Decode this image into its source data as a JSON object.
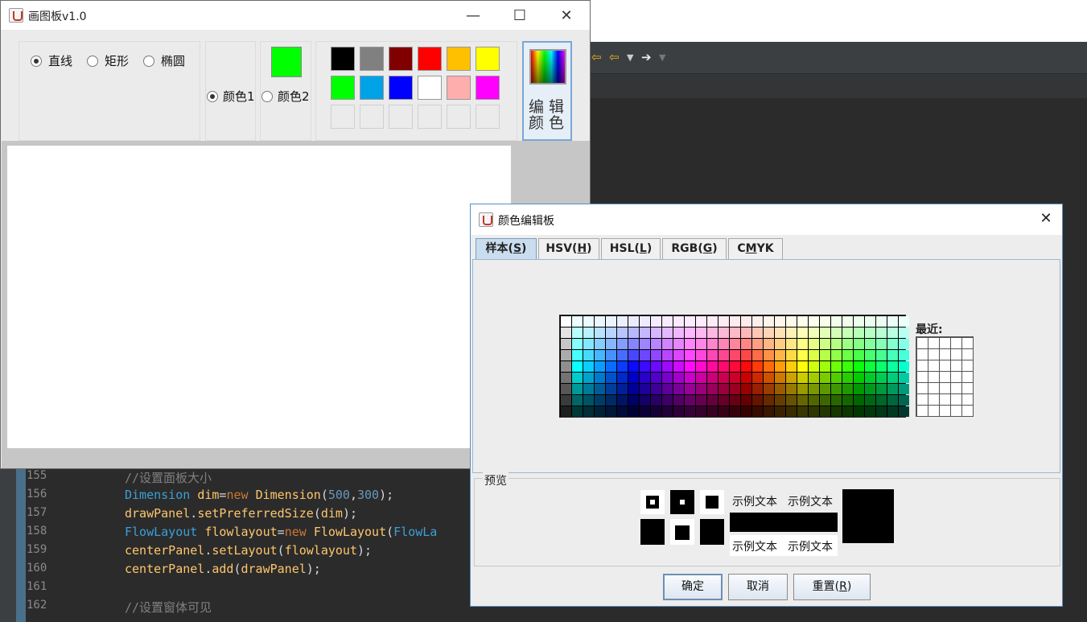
{
  "ide": {
    "code_lines": [
      {
        "num": "155",
        "parts": [
          {
            "c": "cm",
            "t": "//设置面板大小"
          }
        ]
      },
      {
        "num": "156",
        "parts": [
          {
            "c": "ty",
            "t": "Dimension"
          },
          {
            "c": "pl",
            "t": " "
          },
          {
            "c": "va",
            "t": "dim"
          },
          {
            "c": "pl",
            "t": "="
          },
          {
            "c": "kw",
            "t": "new"
          },
          {
            "c": "pl",
            "t": " "
          },
          {
            "c": "va",
            "t": "Dimension"
          },
          {
            "c": "pl",
            "t": "("
          },
          {
            "c": "nu",
            "t": "500"
          },
          {
            "c": "pl",
            "t": ","
          },
          {
            "c": "nu",
            "t": "300"
          },
          {
            "c": "pl",
            "t": ");"
          }
        ]
      },
      {
        "num": "157",
        "parts": [
          {
            "c": "va",
            "t": "drawPanel"
          },
          {
            "c": "pl",
            "t": "."
          },
          {
            "c": "va",
            "t": "setPreferredSize"
          },
          {
            "c": "pl",
            "t": "("
          },
          {
            "c": "va",
            "t": "dim"
          },
          {
            "c": "pl",
            "t": ");"
          }
        ]
      },
      {
        "num": "158",
        "parts": [
          {
            "c": "ty",
            "t": "FlowLayout"
          },
          {
            "c": "pl",
            "t": " "
          },
          {
            "c": "va",
            "t": "flowlayout"
          },
          {
            "c": "pl",
            "t": "="
          },
          {
            "c": "kw",
            "t": "new"
          },
          {
            "c": "pl",
            "t": " "
          },
          {
            "c": "va",
            "t": "FlowLayout"
          },
          {
            "c": "pl",
            "t": "("
          },
          {
            "c": "ty",
            "t": "FlowLa"
          }
        ]
      },
      {
        "num": "159",
        "parts": [
          {
            "c": "va",
            "t": "centerPanel"
          },
          {
            "c": "pl",
            "t": "."
          },
          {
            "c": "va",
            "t": "setLayout"
          },
          {
            "c": "pl",
            "t": "("
          },
          {
            "c": "va",
            "t": "flowlayout"
          },
          {
            "c": "pl",
            "t": ");"
          }
        ]
      },
      {
        "num": "160",
        "parts": [
          {
            "c": "va",
            "t": "centerPanel"
          },
          {
            "c": "pl",
            "t": "."
          },
          {
            "c": "va",
            "t": "add"
          },
          {
            "c": "pl",
            "t": "("
          },
          {
            "c": "va",
            "t": "drawPanel"
          },
          {
            "c": "pl",
            "t": ");"
          }
        ]
      },
      {
        "num": "161",
        "parts": []
      },
      {
        "num": "162",
        "parts": [
          {
            "c": "cm",
            "t": "//设置窗体可见"
          }
        ]
      }
    ],
    "toolbar_icons": [
      "arrow-left-icon",
      "arrow-left-icon",
      "dropdown-icon",
      "arrow-right-icon",
      "dropdown-icon"
    ]
  },
  "app": {
    "title": "画图板v1.0",
    "shapes": [
      "直线",
      "矩形",
      "椭圆"
    ],
    "selected_shape": "直线",
    "color1_label": "颜色1",
    "color2_label": "颜色2",
    "selected_color_slot": "颜色1",
    "current_color": "#00ff00",
    "palette_row1": [
      "#000000",
      "#808080",
      "#800000",
      "#ff0000",
      "#ffc000",
      "#ffff00"
    ],
    "palette_row2": [
      "#00ff00",
      "#00a2e8",
      "#0000ff",
      "#ffffff",
      "#ffaeae",
      "#ff00ff"
    ],
    "edit_color_label": "编辑颜色"
  },
  "dialog": {
    "title": "颜色编辑板",
    "tabs": [
      {
        "label": "样本(",
        "key": "S",
        "suffix": ")",
        "active": true
      },
      {
        "label": "HSV(",
        "key": "H",
        "suffix": ")",
        "active": false
      },
      {
        "label": "HSL(",
        "key": "L",
        "suffix": ")",
        "active": false
      },
      {
        "label": "RGB(",
        "key": "G",
        "suffix": ")",
        "active": false
      },
      {
        "label": "C",
        "key": "M",
        "suffix": "YK",
        "active": false
      }
    ],
    "recent_label": "最近:",
    "preview_label": "预览",
    "sample_text": "示例文本",
    "ok_label": "确定",
    "cancel_label": "取消",
    "reset_label": "重置(",
    "reset_key": "R",
    "reset_suffix": ")"
  }
}
